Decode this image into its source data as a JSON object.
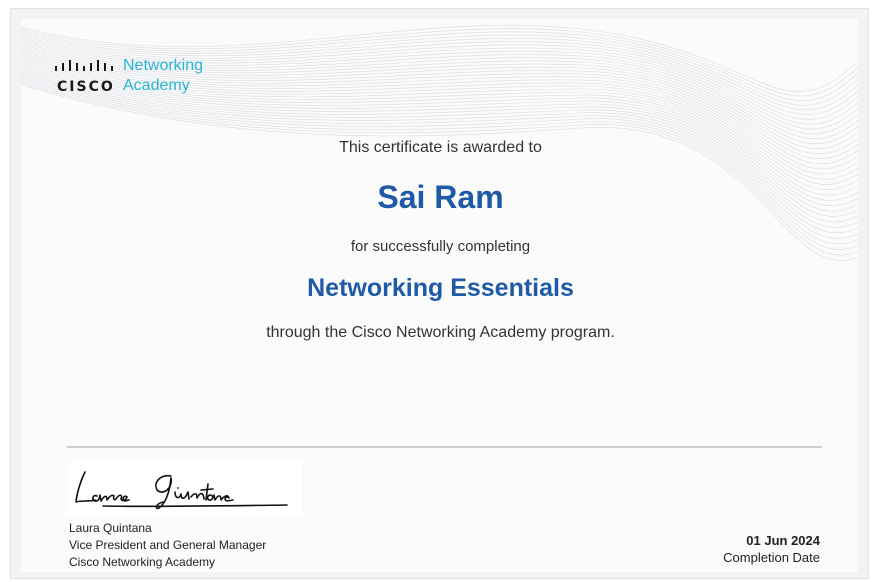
{
  "logo": {
    "brand": "CISCO",
    "subtitle_line1": "Networking",
    "subtitle_line2": "Academy",
    "icon": "cisco-bars-icon"
  },
  "certificate": {
    "intro": "This certificate is awarded to",
    "recipient": "Sai Ram",
    "completing": "for successfully completing",
    "course": "Networking Essentials",
    "program": "through the Cisco Networking Academy program."
  },
  "signatory": {
    "signature": "Laura Quintana",
    "name": "Laura Quintana",
    "title": "Vice President and General Manager",
    "organization": "Cisco Networking Academy"
  },
  "completion": {
    "date": "01 Jun 2024",
    "label": "Completion Date"
  },
  "colors": {
    "accent_blue": "#1f5aa6",
    "logo_cyan": "#28b5d4"
  }
}
